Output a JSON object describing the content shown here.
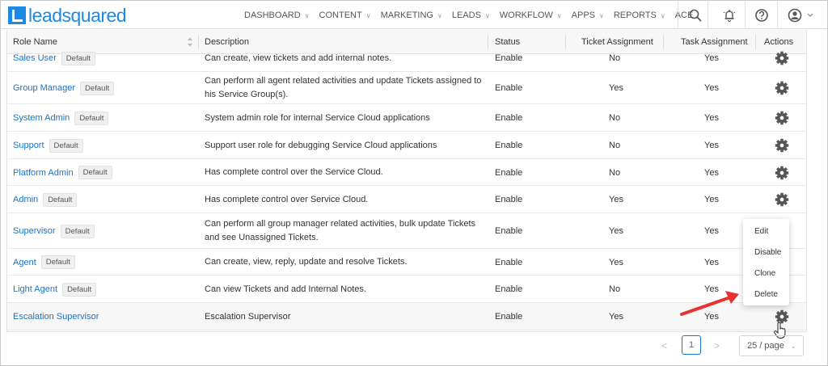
{
  "app": {
    "logo_text": "leadsquared"
  },
  "nav": {
    "items": [
      {
        "label": "DASHBOARD",
        "has_chevron": true
      },
      {
        "label": "CONTENT",
        "has_chevron": true
      },
      {
        "label": "MARKETING",
        "has_chevron": true
      },
      {
        "label": "LEADS",
        "has_chevron": true
      },
      {
        "label": "WORKFLOW",
        "has_chevron": true
      },
      {
        "label": "APPS",
        "has_chevron": true
      },
      {
        "label": "REPORTS",
        "has_chevron": true
      },
      {
        "label": "ACE",
        "has_chevron": false
      }
    ],
    "icons": [
      "search-icon",
      "bell-icon",
      "help-icon",
      "user-avatar-icon"
    ]
  },
  "table": {
    "columns": {
      "role_name": "Role Name",
      "description": "Description",
      "status": "Status",
      "ticket_assignment": "Ticket Assignment",
      "task_assignment": "Task Assignment",
      "actions": "Actions"
    },
    "rows": [
      {
        "name": "Sales User",
        "badge": "Default",
        "description": "Can create, view tickets and add internal notes.",
        "status": "Enable",
        "ticket": "No",
        "task": "Yes"
      },
      {
        "name": "Group Manager",
        "badge": "Default",
        "description": "Can perform all agent related activities and update Tickets assigned to his Service Group(s).",
        "status": "Enable",
        "ticket": "Yes",
        "task": "Yes"
      },
      {
        "name": "System Admin",
        "badge": "Default",
        "description": "System admin role for internal Service Cloud applications",
        "status": "Enable",
        "ticket": "No",
        "task": "Yes"
      },
      {
        "name": "Support",
        "badge": "Default",
        "description": "Support user role for debugging Service Cloud applications",
        "status": "Enable",
        "ticket": "No",
        "task": "Yes"
      },
      {
        "name": "Platform Admin",
        "badge": "Default",
        "description": "Has complete control over the Service Cloud.",
        "status": "Enable",
        "ticket": "No",
        "task": "Yes"
      },
      {
        "name": "Admin",
        "badge": "Default",
        "description": "Has complete control over Service Cloud.",
        "status": "Enable",
        "ticket": "Yes",
        "task": "Yes"
      },
      {
        "name": "Supervisor",
        "badge": "Default",
        "description": "Can perform all group manager related activities, bulk update Tickets and see Unassigned Tickets.",
        "status": "Enable",
        "ticket": "Yes",
        "task": "Yes"
      },
      {
        "name": "Agent",
        "badge": "Default",
        "description": "Can create, view, reply, update and resolve Tickets.",
        "status": "Enable",
        "ticket": "Yes",
        "task": "Yes"
      },
      {
        "name": "Light Agent",
        "badge": "Default",
        "description": "Can view Tickets and add Internal Notes.",
        "status": "Enable",
        "ticket": "No",
        "task": "Yes"
      },
      {
        "name": "Escalation Supervisor",
        "badge": "",
        "description": "Escalation Supervisor",
        "status": "Enable",
        "ticket": "Yes",
        "task": "Yes"
      }
    ]
  },
  "action_menu": {
    "items": [
      "Edit",
      "Disable",
      "Clone",
      "Delete"
    ]
  },
  "pagination": {
    "prev": "<",
    "current_page": "1",
    "next": ">",
    "page_size": "25 / page"
  },
  "colors": {
    "accent": "#1b73c9",
    "logo": "#1e88e5",
    "arrow": "#e8322f",
    "gear": "#555555"
  }
}
